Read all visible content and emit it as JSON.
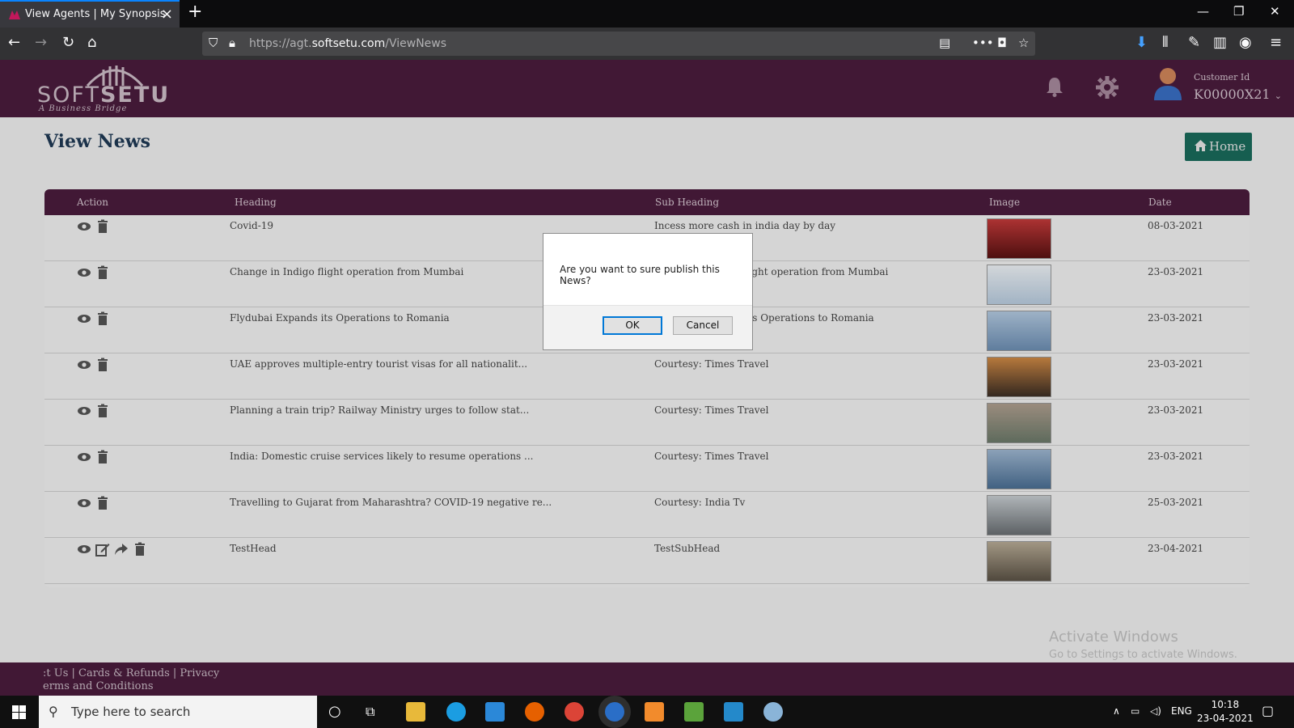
{
  "browser": {
    "tab_title": "View Agents | My Synopsis",
    "url_prefix": "https://agt.",
    "url_domain": "softsetu.com",
    "url_path": "/ViewNews"
  },
  "header": {
    "logo_soft": "SOFT",
    "logo_setu": "SETU",
    "logo_tagline": "A Business Bridge",
    "customer_label": "Customer Id",
    "customer_id": "K00000X21"
  },
  "page": {
    "title": "View News",
    "home_label": "Home"
  },
  "table": {
    "columns": [
      "Action",
      "Heading",
      "Sub Heading",
      "Image",
      "Date"
    ],
    "rows": [
      {
        "heading": "Covid-19",
        "subheading": "Incess more cash in india day by day",
        "date": "08-03-2021"
      },
      {
        "heading": "Change in Indigo flight operation from Mumbai",
        "subheading": "Change in Indigo flight operation from Mumbai",
        "date": "23-03-2021"
      },
      {
        "heading": "Flydubai Expands its Operations to Romania",
        "subheading": "Flydubai Expands its Operations to Romania",
        "date": "23-03-2021"
      },
      {
        "heading": "UAE approves multiple-entry tourist visas for all nationalit...",
        "subheading": "Courtesy: Times Travel",
        "date": "23-03-2021"
      },
      {
        "heading": "Planning a train trip? Railway Ministry urges to follow stat...",
        "subheading": "Courtesy: Times Travel",
        "date": "23-03-2021"
      },
      {
        "heading": "India: Domestic cruise services likely to resume operations ...",
        "subheading": "Courtesy: Times Travel",
        "date": "23-03-2021"
      },
      {
        "heading": "Travelling to Gujarat from Maharashtra? COVID-19 negative re...",
        "subheading": "Courtesy: India Tv",
        "date": "25-03-2021"
      },
      {
        "heading": "TestHead",
        "subheading": "TestSubHead",
        "date": "23-04-2021"
      }
    ]
  },
  "footer": {
    "line1": ":t Us | Cards & Refunds | Privacy",
    "line2": "erms and Conditions"
  },
  "watermark": {
    "line1": "Activate Windows",
    "line2": "Go to Settings to activate Windows."
  },
  "dialog": {
    "message": "Are you want to sure publish this News?",
    "ok_label": "OK",
    "cancel_label": "Cancel"
  },
  "taskbar": {
    "search_placeholder": "Type here to search",
    "language": "ENG",
    "time": "10:18",
    "date": "23-04-2021"
  },
  "colors": {
    "brand": "#4a1c3d",
    "home_button": "#1a6b5c",
    "title": "#1f3a55"
  }
}
